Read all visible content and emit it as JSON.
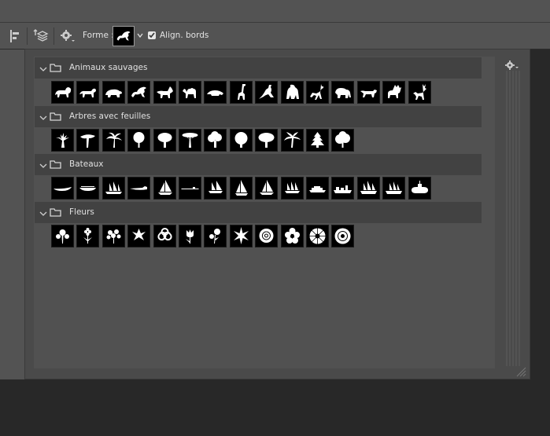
{
  "toolbar": {
    "shape_label": "Forme :",
    "align_label": "Align. bords",
    "align_checked": true
  },
  "panel": {
    "groups": [
      {
        "label": "Animaux sauvages",
        "shapes": [
          "lion",
          "lioness",
          "bear",
          "hippogriff",
          "wolf",
          "camel",
          "mole",
          "giraffe",
          "kangaroo",
          "gorilla",
          "gazelle",
          "elephant",
          "wild-dog",
          "moose",
          "deer"
        ]
      },
      {
        "label": "Arbres avec feuilles",
        "shapes": [
          "tree-bare",
          "tree-flat",
          "palm-tree",
          "round-tree",
          "broad-tree",
          "acacia",
          "lumpy-tree",
          "oak",
          "spreading-tree",
          "palm-tree-2",
          "fir",
          "leafy-tree"
        ]
      },
      {
        "label": "Bateaux",
        "shapes": [
          "canoe",
          "rowboat",
          "tall-ship",
          "speedboat",
          "sailboat",
          "tanker",
          "schooner",
          "yacht",
          "sail-yacht",
          "clipper",
          "ferry",
          "cargo-ship",
          "galleon",
          "frigate",
          "submarine"
        ]
      },
      {
        "label": "Fleurs",
        "shapes": [
          "flower-ornament",
          "hyacinth",
          "flower-cluster",
          "lily",
          "flower-outline",
          "tulip",
          "rose-branch",
          "starflower",
          "rose",
          "blossom",
          "daisy",
          "dahlia"
        ]
      }
    ]
  },
  "colors": {
    "panel_bg": "#4a4a4a",
    "header_bg": "#424242",
    "tile_bg": "#000000",
    "shape_fill": "#ffffff"
  }
}
